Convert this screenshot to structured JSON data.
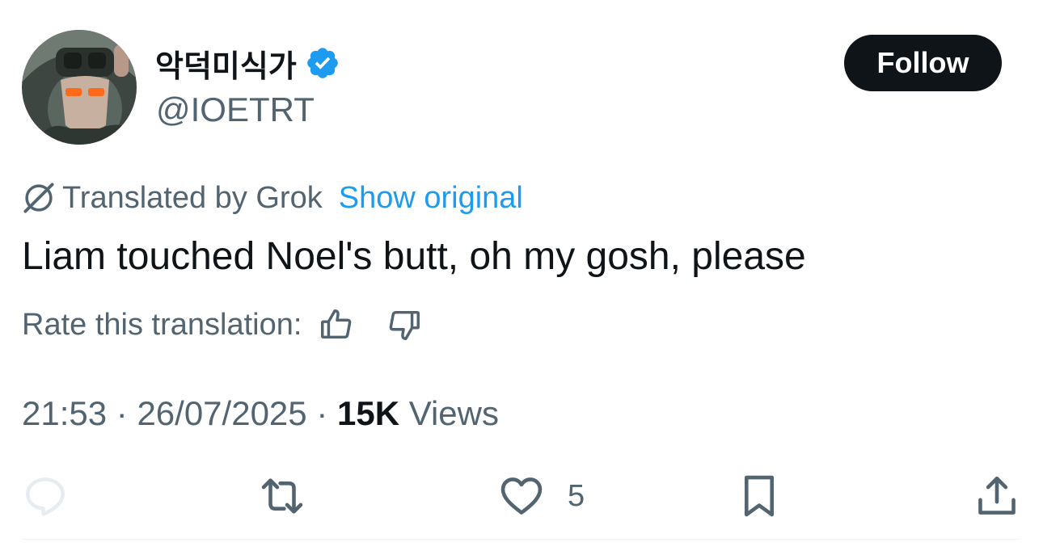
{
  "author": {
    "display_name": "악덕미식가",
    "handle": "@IOETRT",
    "verified": true,
    "verified_color": "#1d9bf0",
    "avatar_icon": "avatar-soldier-photo"
  },
  "follow_button": {
    "label": "Follow",
    "bg_color": "#0f1419",
    "text_color": "#ffffff"
  },
  "translation": {
    "icon": "grok-icon",
    "label": "Translated by Grok",
    "show_original": "Show original",
    "link_color": "#1d9bf0"
  },
  "tweet": {
    "text": "Liam touched Noel's butt, oh my gosh, please"
  },
  "rating": {
    "label": "Rate this translation:",
    "thumbs_up_icon": "thumbs-up-icon",
    "thumbs_down_icon": "thumbs-down-icon"
  },
  "meta": {
    "time": "21:53",
    "separator": " · ",
    "date": "26/07/2025",
    "views_count": "15K",
    "views_label": " Views"
  },
  "actions": {
    "reply_icon": "reply-icon",
    "retweet_icon": "retweet-icon",
    "like_icon": "heart-icon",
    "like_count": "5",
    "bookmark_icon": "bookmark-icon",
    "share_icon": "share-icon"
  },
  "colors": {
    "text": "#0f1419",
    "secondary": "#536471",
    "divider": "#eff3f4"
  }
}
